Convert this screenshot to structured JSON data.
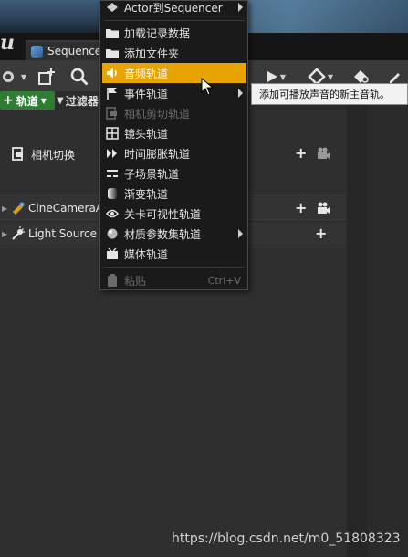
{
  "tab": {
    "label": "Sequence"
  },
  "filter_bar": {
    "track_label": "轨道",
    "filter_label": "过滤器"
  },
  "outliner": {
    "camera_cut_label": "相机切换",
    "rows": [
      {
        "label": "CineCameraAc"
      },
      {
        "label": "Light Source"
      }
    ]
  },
  "menu": {
    "top_item": "Actor到Sequencer",
    "items": [
      {
        "label": "加载记录数据",
        "icon": "folder-icon"
      },
      {
        "label": "添加文件夹",
        "icon": "folder-icon"
      },
      {
        "label": "音频轨道",
        "icon": "speaker-icon",
        "highlighted": true
      },
      {
        "label": "事件轨道",
        "icon": "flag-icon",
        "submenu": true
      },
      {
        "label": "相机剪切轨道",
        "icon": "camera-cut-icon",
        "disabled": true
      },
      {
        "label": "镜头轨道",
        "icon": "film-grid-icon"
      },
      {
        "label": "时间膨胀轨道",
        "icon": "time-dilation-icon"
      },
      {
        "label": "子场景轨道",
        "icon": "subscene-icon"
      },
      {
        "label": "渐变轨道",
        "icon": "fade-icon"
      },
      {
        "label": "关卡可视性轨道",
        "icon": "eye-icon"
      },
      {
        "label": "材质参数集轨道",
        "icon": "material-icon",
        "submenu": true
      },
      {
        "label": "媒体轨道",
        "icon": "media-icon"
      }
    ],
    "paste_label": "粘贴",
    "paste_shortcut": "Ctrl+V"
  },
  "tooltip": {
    "text": "添加可播放声音的新主音轨。"
  },
  "watermark": "https://blog.csdn.net/m0_51808323",
  "colors": {
    "highlight": "#e8a300",
    "track_button": "#2e7d32"
  }
}
